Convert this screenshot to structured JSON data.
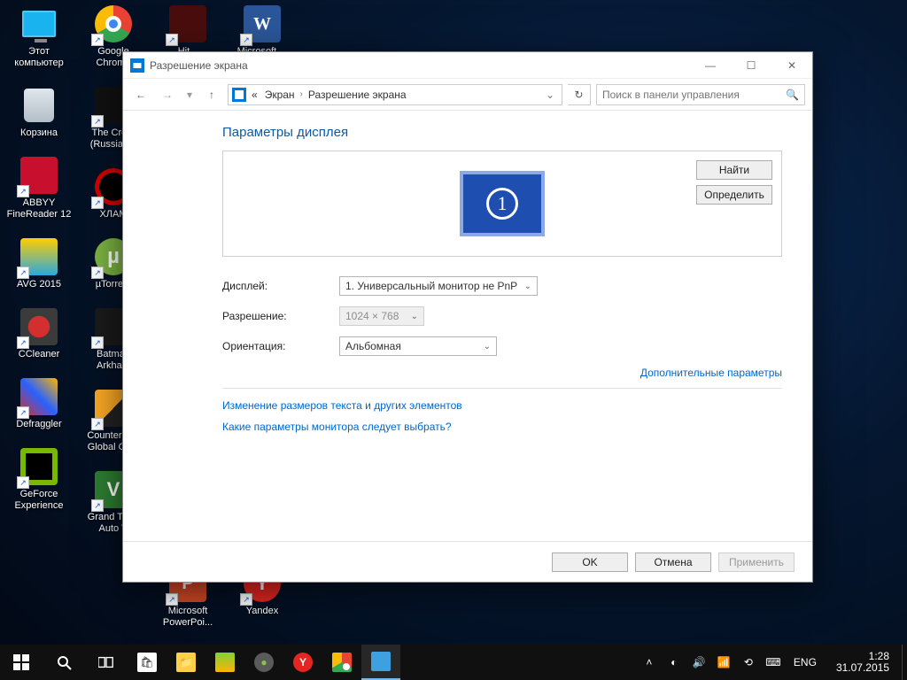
{
  "desktop": {
    "c0": [
      {
        "label": "Этот\nкомпьютер",
        "icon": "pc"
      },
      {
        "label": "Корзина",
        "icon": "bin"
      },
      {
        "label": "ABBYY\nFineReader 12",
        "icon": "abbyy",
        "shortcut": true
      },
      {
        "label": "AVG 2015",
        "icon": "avg",
        "shortcut": true
      },
      {
        "label": "CCleaner",
        "icon": "ccl",
        "shortcut": true
      },
      {
        "label": "Defraggler",
        "icon": "defr",
        "shortcut": true
      },
      {
        "label": "GeForce\nExperience",
        "icon": "nvidia",
        "shortcut": true
      }
    ],
    "c1": [
      {
        "label": "Google\nChrome",
        "icon": "chrome",
        "shortcut": true
      },
      {
        "label": "The Cre...\n(Russian...",
        "icon": "crew",
        "shortcut": true
      },
      {
        "label": "ХЛАМ",
        "icon": "ban",
        "shortcut": true
      },
      {
        "label": "µTorrent",
        "icon": "utor",
        "shortcut": true
      },
      {
        "label": "Batman\nArkha...",
        "icon": "batman",
        "shortcut": true
      },
      {
        "label": "Counter-S...\nGlobal Off...",
        "icon": "csgo",
        "shortcut": true
      },
      {
        "label": "Grand Theft\nAuto V",
        "icon": "gtav",
        "shortcut": true
      }
    ],
    "c2": [
      {
        "label": "Hit...",
        "icon": "hitman",
        "shortcut": true
      },
      {
        "label": "",
        "icon": "blank"
      },
      {
        "label": "",
        "icon": "blank"
      },
      {
        "label": "",
        "icon": "blank"
      },
      {
        "label": "",
        "icon": "blank"
      },
      {
        "label": "",
        "icon": "blank"
      },
      {
        "label": "Microsoft\nPowerPoi...",
        "icon": "ppt",
        "shortcut": true
      }
    ],
    "c3": [
      {
        "label": "Microsoft ...",
        "icon": "word",
        "shortcut": true
      },
      {
        "label": "",
        "icon": "blank"
      },
      {
        "label": "",
        "icon": "blank"
      },
      {
        "label": "",
        "icon": "blank"
      },
      {
        "label": "",
        "icon": "blank"
      },
      {
        "label": "",
        "icon": "blank"
      },
      {
        "label": "Yandex",
        "icon": "yandex",
        "shortcut": true
      }
    ]
  },
  "window": {
    "title": "Разрешение экрана",
    "breadcrumb": {
      "pre": "«",
      "a": "Экран",
      "b": "Разрешение экрана"
    },
    "search_placeholder": "Поиск в панели управления",
    "heading": "Параметры дисплея",
    "monitor_number": "1",
    "buttons": {
      "find": "Найти",
      "identify": "Определить"
    },
    "rows": {
      "display": {
        "label": "Дисплей:",
        "value": "1. Универсальный монитор не PnP"
      },
      "resolution": {
        "label": "Разрешение:",
        "value": "1024 × 768"
      },
      "orientation": {
        "label": "Ориентация:",
        "value": "Альбомная"
      }
    },
    "advanced": "Дополнительные параметры",
    "link1": "Изменение размеров текста и других элементов",
    "link2": "Какие параметры монитора следует выбрать?",
    "footer": {
      "ok": "OK",
      "cancel": "Отмена",
      "apply": "Применить"
    }
  },
  "taskbar": {
    "lang": "ENG",
    "time": "1:28",
    "date": "31.07.2015"
  }
}
